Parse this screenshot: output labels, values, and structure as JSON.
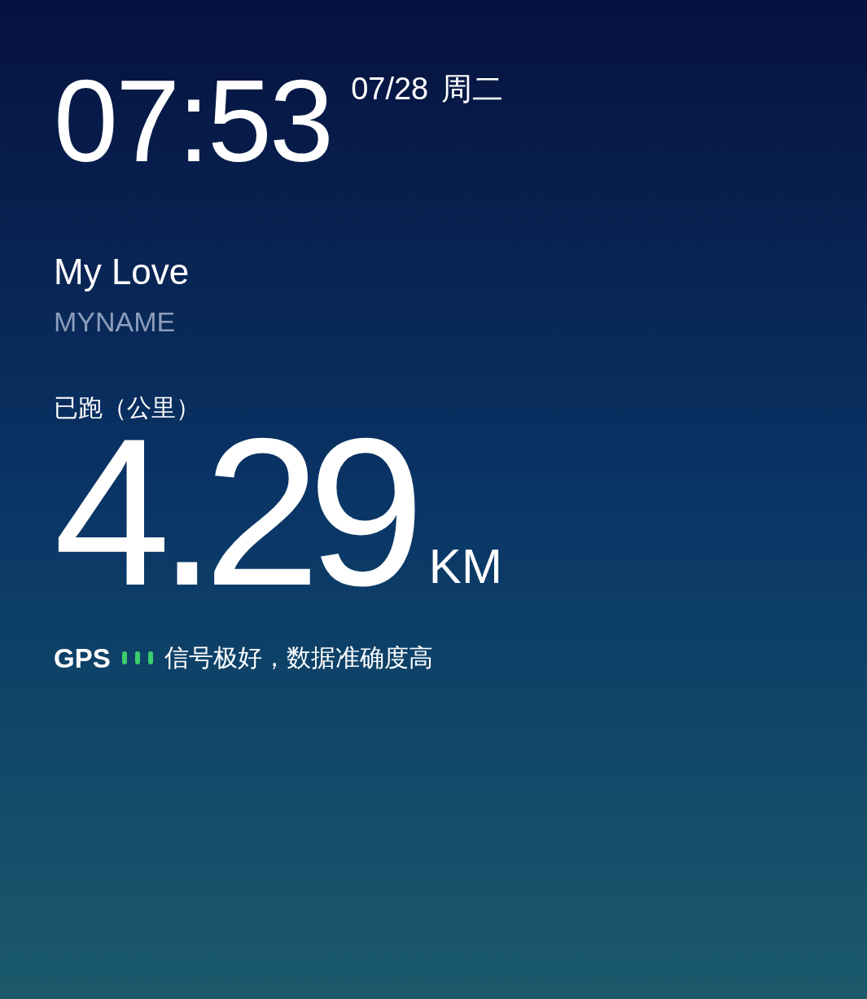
{
  "clock": {
    "time": "07:53",
    "date": "07/28",
    "weekday": "周二"
  },
  "song": {
    "title": "My Love",
    "artist": "MYNAME"
  },
  "run": {
    "label": "已跑（公里）",
    "distance": "4.29",
    "unit": "KM"
  },
  "gps": {
    "label": "GPS",
    "status": "信号极好，数据准确度高"
  }
}
